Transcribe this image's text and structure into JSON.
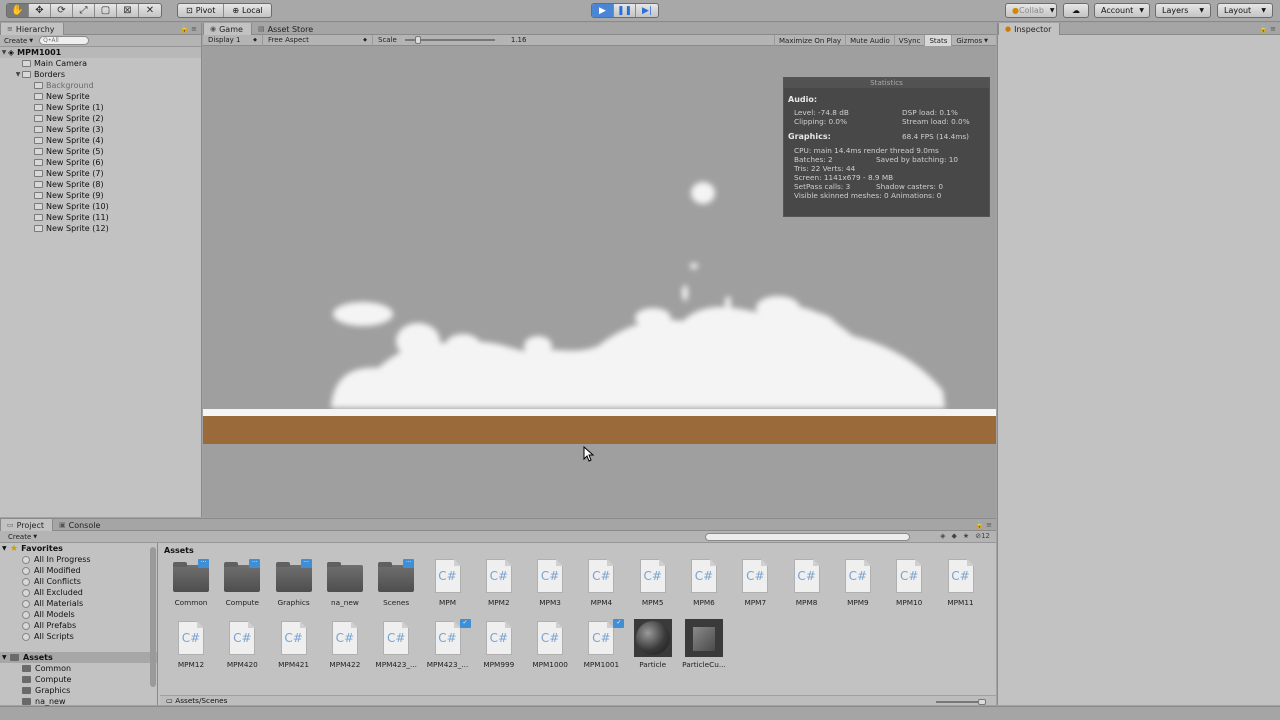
{
  "toolbar": {
    "tools": [
      "hand-icon",
      "move-icon",
      "rotate-icon",
      "scale-icon",
      "rect-icon",
      "transform-icon",
      "custom-tool-icon"
    ],
    "pivot_label": "Pivot",
    "local_label": "Local",
    "collab_label": "Collab",
    "account_label": "Account",
    "layers_label": "Layers",
    "layout_label": "Layout"
  },
  "hierarchy": {
    "tab_label": "Hierarchy",
    "create_label": "Create",
    "search_placeholder": "Q•All",
    "scene": "MPM1001",
    "items": [
      {
        "label": "Main Camera",
        "depth": 1
      },
      {
        "label": "Borders",
        "depth": 1,
        "expanded": true
      },
      {
        "label": "Background",
        "depth": 2,
        "dim": true
      },
      {
        "label": "New Sprite",
        "depth": 2
      },
      {
        "label": "New Sprite (1)",
        "depth": 2
      },
      {
        "label": "New Sprite (2)",
        "depth": 2
      },
      {
        "label": "New Sprite (3)",
        "depth": 2
      },
      {
        "label": "New Sprite (4)",
        "depth": 2
      },
      {
        "label": "New Sprite (5)",
        "depth": 2
      },
      {
        "label": "New Sprite (6)",
        "depth": 2
      },
      {
        "label": "New Sprite (7)",
        "depth": 2
      },
      {
        "label": "New Sprite (8)",
        "depth": 2
      },
      {
        "label": "New Sprite (9)",
        "depth": 2
      },
      {
        "label": "New Sprite (10)",
        "depth": 2
      },
      {
        "label": "New Sprite (11)",
        "depth": 2
      },
      {
        "label": "New Sprite (12)",
        "depth": 2
      }
    ]
  },
  "game": {
    "tab_game": "Game",
    "tab_store": "Asset Store",
    "display": "Display 1",
    "aspect": "Free Aspect",
    "scale_label": "Scale",
    "scale_value": "1.16",
    "maximize": "Maximize On Play",
    "mute": "Mute Audio",
    "vsync": "VSync",
    "stats": "Stats",
    "gizmos": "Gizmos"
  },
  "statistics": {
    "title": "Statistics",
    "audio_h": "Audio:",
    "level": "Level: -74.8 dB",
    "clipping": "Clipping: 0.0%",
    "dsp": "DSP load: 0.1%",
    "stream": "Stream load: 0.0%",
    "graphics_h": "Graphics:",
    "fps": "68.4 FPS (14.4ms)",
    "cpu": "CPU: main 14.4ms  render thread 9.0ms",
    "batches": "Batches: 2",
    "saved": "Saved by batching: 10",
    "tris": "Tris: 22   Verts: 44",
    "screen": "Screen: 1141x679 - 8.9 MB",
    "setpass": "SetPass calls: 3",
    "shadow": "Shadow casters: 0",
    "skinned": "Visible skinned meshes: 0  Animations: 0"
  },
  "inspector": {
    "tab_label": "Inspector"
  },
  "project": {
    "tab_project": "Project",
    "tab_console": "Console",
    "create_label": "Create",
    "count": "12",
    "favorites_h": "Favorites",
    "favorites": [
      "All In Progress",
      "All Modified",
      "All Conflicts",
      "All Excluded",
      "All Materials",
      "All Models",
      "All Prefabs",
      "All Scripts"
    ],
    "assets_h": "Assets",
    "asset_folders": [
      "Common",
      "Compute",
      "Graphics",
      "na_new"
    ],
    "assets_title": "Assets",
    "footer_path": "Assets/Scenes",
    "grid": [
      {
        "label": "Common",
        "kind": "folder",
        "badge": true
      },
      {
        "label": "Compute",
        "kind": "folder",
        "badge": true
      },
      {
        "label": "Graphics",
        "kind": "folder",
        "badge": true
      },
      {
        "label": "na_new",
        "kind": "folder",
        "badge": false
      },
      {
        "label": "Scenes",
        "kind": "folder",
        "badge": true
      },
      {
        "label": "MPM",
        "kind": "cs"
      },
      {
        "label": "MPM2",
        "kind": "cs"
      },
      {
        "label": "MPM3",
        "kind": "cs"
      },
      {
        "label": "MPM4",
        "kind": "cs"
      },
      {
        "label": "MPM5",
        "kind": "cs"
      },
      {
        "label": "MPM6",
        "kind": "cs"
      },
      {
        "label": "MPM7",
        "kind": "cs"
      },
      {
        "label": "MPM8",
        "kind": "cs"
      },
      {
        "label": "MPM9",
        "kind": "cs"
      },
      {
        "label": "MPM10",
        "kind": "cs"
      },
      {
        "label": "MPM11",
        "kind": "cs"
      },
      {
        "label": "MPM12",
        "kind": "cs"
      },
      {
        "label": "MPM420",
        "kind": "cs"
      },
      {
        "label": "MPM421",
        "kind": "cs"
      },
      {
        "label": "MPM422",
        "kind": "cs"
      },
      {
        "label": "MPM423_...",
        "kind": "cs"
      },
      {
        "label": "MPM423_...",
        "kind": "cs",
        "check": true
      },
      {
        "label": "MPM999",
        "kind": "cs"
      },
      {
        "label": "MPM1000",
        "kind": "cs"
      },
      {
        "label": "MPM1001",
        "kind": "cs",
        "check": true
      },
      {
        "label": "Particle",
        "kind": "material"
      },
      {
        "label": "ParticleCu...",
        "kind": "mesh"
      }
    ]
  }
}
